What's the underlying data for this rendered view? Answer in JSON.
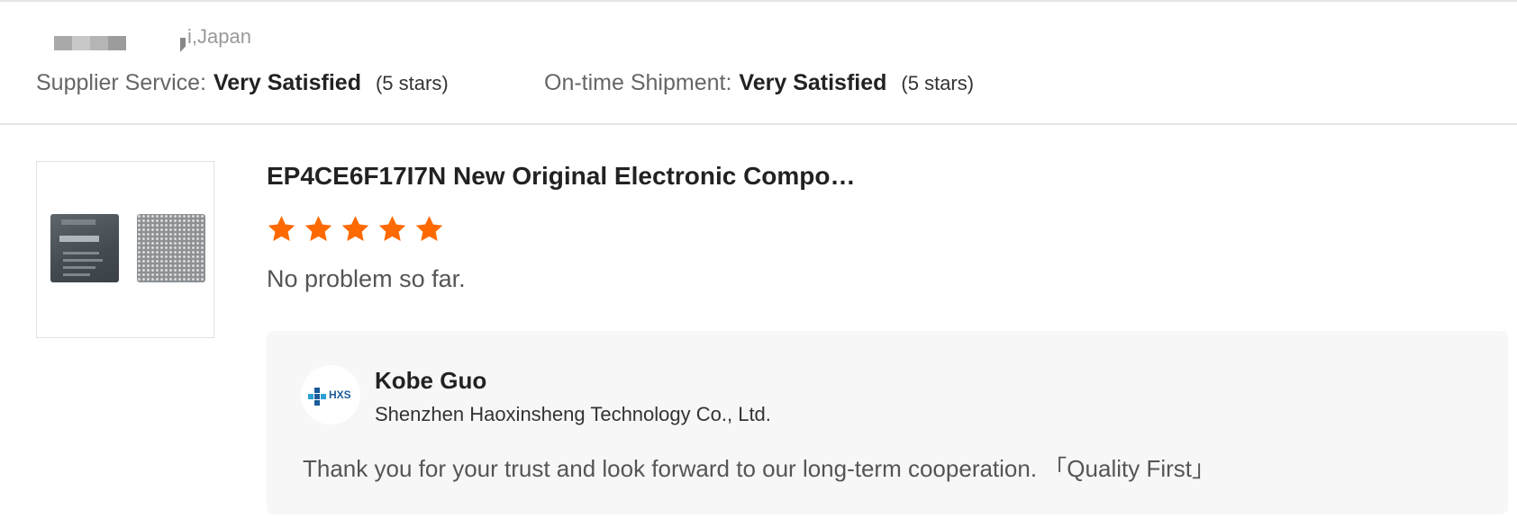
{
  "reviewer": {
    "location": "i,Japan"
  },
  "ratings": [
    {
      "label": "Supplier Service:",
      "value": "Very Satisfied",
      "stars_text": "(5 stars)"
    },
    {
      "label": "On-time Shipment:",
      "value": "Very Satisfied",
      "stars_text": "(5 stars)"
    }
  ],
  "product": {
    "title": "EP4CE6F17I7N New Original Electronic Compo…",
    "rating_stars": 5,
    "star_color": "#ff6a00",
    "review_text": "No problem so far."
  },
  "reply": {
    "avatar_text": "HXS",
    "name": "Kobe Guo",
    "company": "Shenzhen Haoxinsheng Technology Co., Ltd.",
    "message": "Thank you for your trust and look forward to our long-term cooperation. 「Quality First」"
  }
}
